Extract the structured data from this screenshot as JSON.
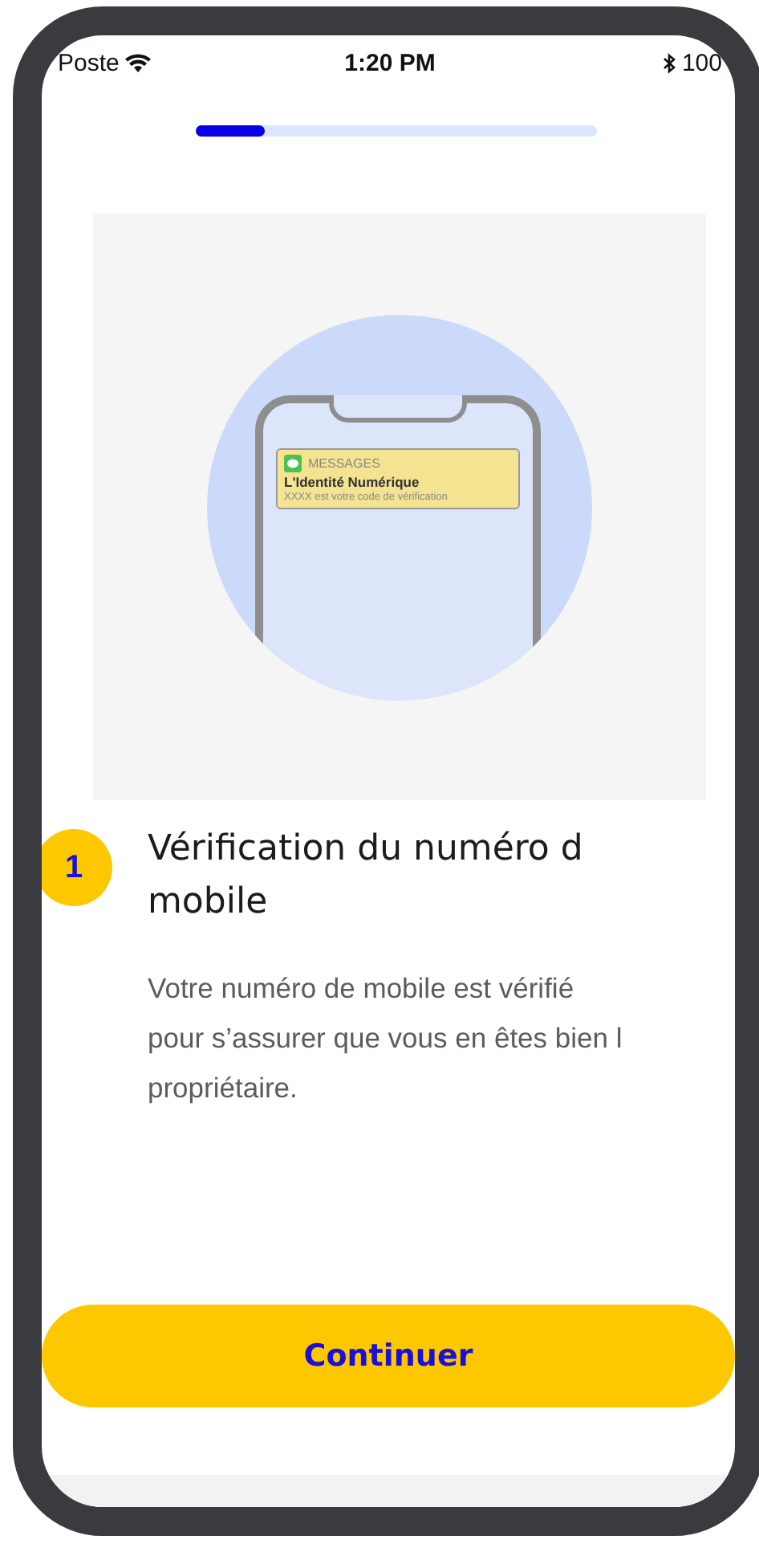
{
  "status_bar": {
    "carrier": "Poste",
    "time": "1:20 PM",
    "battery": "100"
  },
  "progress": {
    "level": 0.17
  },
  "illustration": {
    "notification": {
      "app": "MESSAGES",
      "title": "L'Identité Numérique",
      "body": "XXXX est votre code de vérification"
    }
  },
  "step": {
    "number": "1",
    "title": "Vérification du numéro d mobile",
    "description": "Votre numéro de mobile est vérifié pour s’assurer que vous en êtes bien l propriétaire."
  },
  "button": {
    "label": "Continuer"
  }
}
